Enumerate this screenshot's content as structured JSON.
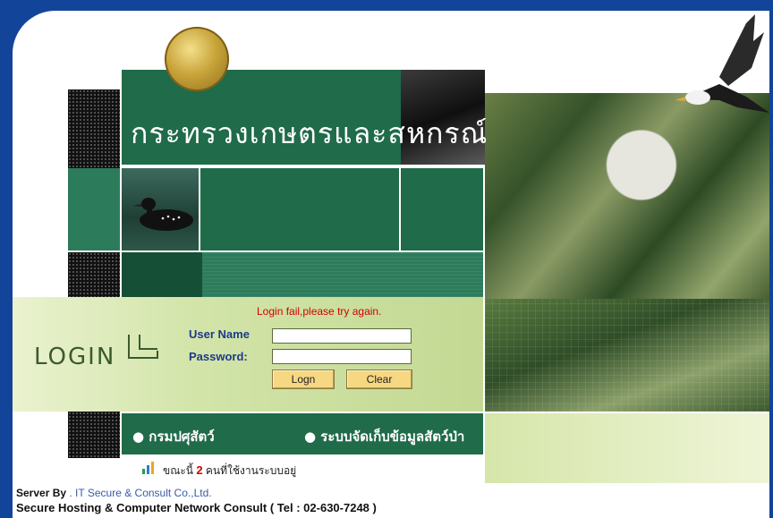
{
  "header": {
    "ministry_title": "กระทรวงเกษตรและสหกรณ์"
  },
  "login": {
    "logo_text": "LOGIN",
    "error_message": "Login fail,please try again.",
    "username_label": "User Name",
    "password_label": "Password:",
    "username_value": "",
    "password_value": "",
    "login_button": "Logn",
    "clear_button": "Clear"
  },
  "nav": {
    "item1": "● กรมปศุสัตว์",
    "item2": "● ระบบจัดเก็บข้อมูลสัตว์ป่า"
  },
  "online": {
    "prefix": "ขณะนี้",
    "count": "2",
    "suffix": "คนที่ใช้งานระบบอยู่"
  },
  "footer": {
    "server_label": "Server By",
    "server_company": ". IT Secure & Consult Co.,Ltd.",
    "hosting_line": "Secure Hosting & Computer Network Consult ( Tel : 02-630-7248 )"
  },
  "colors": {
    "border_blue": "#12459a",
    "ministry_green": "#1f6b4a",
    "error_red": "#d40000",
    "button_yellow": "#f6d782"
  }
}
